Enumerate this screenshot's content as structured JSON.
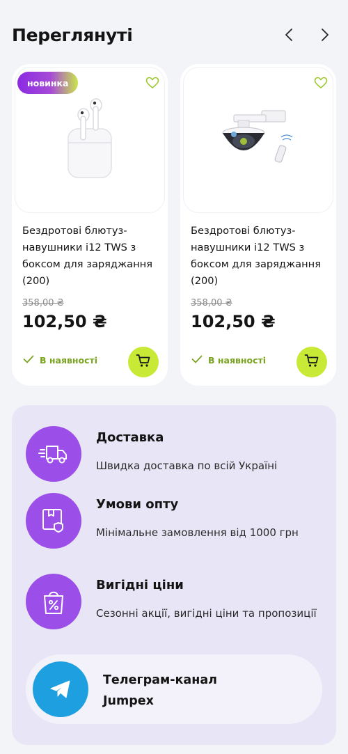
{
  "header": {
    "title": "Переглянуті",
    "prev_icon": "chevron-left-icon",
    "next_icon": "chevron-right-icon"
  },
  "products": [
    {
      "badge": "новинка",
      "image": "airpods-case-image",
      "title": "Бездротові блютуз-навушники i12 TWS з боксом для заряджання (200)",
      "old_price": "358,00 ₴",
      "price": "102,50 ₴",
      "stock": "В наявності"
    },
    {
      "badge": "",
      "image": "dome-camera-image",
      "title": "Бездротові блютуз-навушники i12 TWS з боксом для заряджання (200)",
      "old_price": "358,00 ₴",
      "price": "102,50 ₴",
      "stock": "В наявності"
    }
  ],
  "features": [
    {
      "icon": "delivery-truck-icon",
      "title": "Доставка",
      "desc": "Швидка доставка по всій Україні"
    },
    {
      "icon": "wholesale-box-icon",
      "title": "Умови опту",
      "desc": "Мінімальне замовлення від 1000 грн"
    },
    {
      "icon": "discount-bag-icon",
      "title": "Вигідні ціни",
      "desc": "Сезонні акції, вигідні ціни та пропозиції"
    }
  ],
  "telegram": {
    "icon": "telegram-icon",
    "label": "Телеграм-канал Jumpex"
  },
  "colors": {
    "accent_lime": "#c8e935",
    "accent_purple": "#9b4ee8",
    "telegram_blue": "#1e9fe0",
    "in_stock_green": "#7aa321"
  }
}
